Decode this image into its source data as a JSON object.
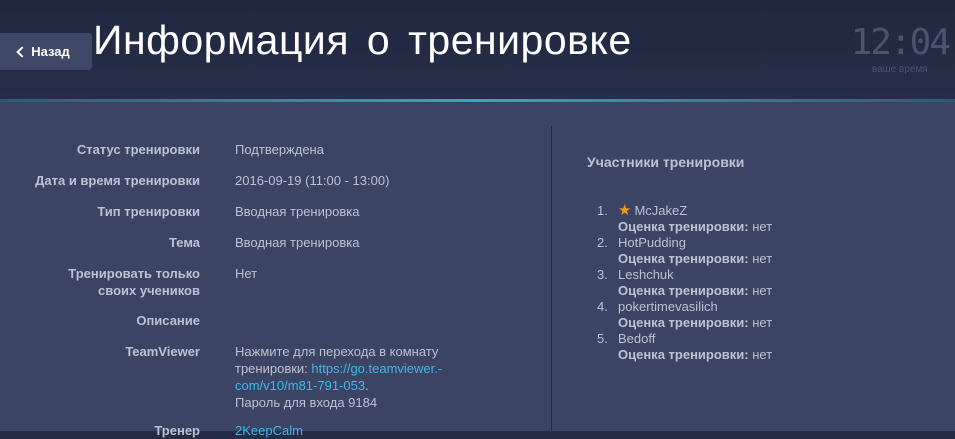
{
  "header": {
    "back_label": "Назад",
    "title": "Информация о тренировке",
    "clock_time": "12:04",
    "clock_label": "ваше время"
  },
  "details": {
    "status": {
      "label": "Статус тренировки",
      "value": "Подтверждена"
    },
    "datetime": {
      "label": "Дата и время тренировки",
      "value": "2016-09-19 (11:00 - 13:00)"
    },
    "type": {
      "label": "Тип тренировки",
      "value": "Вводная тренировка"
    },
    "topic": {
      "label": "Тема",
      "value": "Вводная тренировка"
    },
    "own_students": {
      "label_line1": "Тренировать только",
      "label_line2": "своих учеников",
      "value": "Нет"
    },
    "description": {
      "label": "Описание",
      "value": ""
    },
    "teamviewer": {
      "label": "TeamViewer",
      "text_line1": "Нажмите для перехода в комнату",
      "text_line2": "тренировки:",
      "link_line1": "https://go.teamviewer.-",
      "link_line2": "com/v10/m81-791-053",
      "dot": ".",
      "password": "Пароль для входа 9184"
    },
    "trainer": {
      "label": "Тренер",
      "value": "2KeepCalm"
    }
  },
  "participants": {
    "title": "Участники тренировки",
    "rating_label": "Оценка тренировки:",
    "items": [
      {
        "num": "1.",
        "name": "McJakeZ",
        "rating": "нет",
        "star": "★"
      },
      {
        "num": "2.",
        "name": "HotPudding",
        "rating": "нет"
      },
      {
        "num": "3.",
        "name": "Leshchuk",
        "rating": "нет"
      },
      {
        "num": "4.",
        "name": "pokertimevasilich",
        "rating": "нет"
      },
      {
        "num": "5.",
        "name": "Bedoff",
        "rating": "нет"
      }
    ]
  },
  "colors": {
    "accent_link": "#3fb8ef",
    "star": "#f39a1d",
    "panel": "#3b4462",
    "header": "#242b44"
  }
}
